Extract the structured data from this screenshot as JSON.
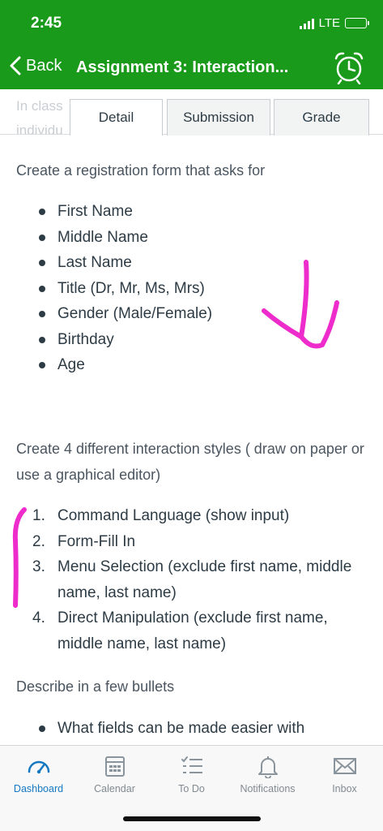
{
  "status_bar": {
    "time": "2:45",
    "network": "LTE"
  },
  "nav": {
    "back_label": "Back",
    "title": "Assignment 3: Interaction..."
  },
  "ghost": {
    "line1": "In class",
    "line2": "individu"
  },
  "tabs": [
    {
      "label": "Detail",
      "active": true
    },
    {
      "label": "Submission",
      "active": false
    },
    {
      "label": "Grade",
      "active": false
    }
  ],
  "body": {
    "intro": "Create a registration form that asks for",
    "fields": [
      "First Name",
      "Middle Name",
      "Last Name",
      "Title (Dr, Mr, Ms, Mrs)",
      "Gender (Male/Female)",
      "Birthday",
      "Age"
    ],
    "styles_intro": "Create 4 different interaction styles ( draw on paper or use a graphical editor)",
    "styles": [
      {
        "num": "1.",
        "text": "Command Language (show input)"
      },
      {
        "num": "2.",
        "text": "Form-Fill In"
      },
      {
        "num": "3.",
        "text": "Menu Selection (exclude first name, middle name, last name)"
      },
      {
        "num": "4.",
        "text": "Direct Manipulation (exclude first name, middle name, last name)"
      }
    ],
    "describe_intro": "Describe in a few bullets",
    "describe_items": [
      "What fields can be made easier with"
    ]
  },
  "tabbar": [
    {
      "label": "Dashboard",
      "icon": "dashboard-icon",
      "active": true
    },
    {
      "label": "Calendar",
      "icon": "calendar-icon",
      "active": false
    },
    {
      "label": "To Do",
      "icon": "todo-list-icon",
      "active": false
    },
    {
      "label": "Notifications",
      "icon": "bell-icon",
      "active": false
    },
    {
      "label": "Inbox",
      "icon": "envelope-icon",
      "active": false
    }
  ],
  "colors": {
    "header_green": "#1a9a1a",
    "active_blue": "#1578c2",
    "annotation_magenta": "#ee2ccc"
  }
}
